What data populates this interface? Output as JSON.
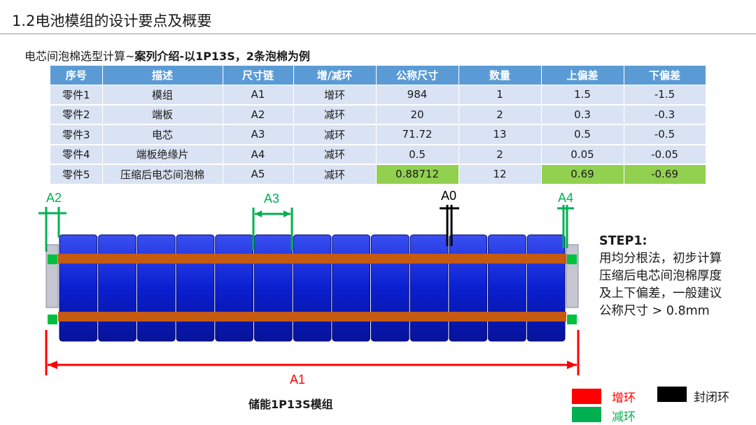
{
  "header": {
    "title": "1.2电池模组的设计要点及概要"
  },
  "subtitle": {
    "prefix": "电芯间泡棉选型计算~",
    "bold": "案列介绍-以1P13S，2条泡棉为例"
  },
  "table": {
    "headers": [
      "序号",
      "描述",
      "尺寸链",
      "增/减环",
      "公称尺寸",
      "数量",
      "上偏差",
      "下偏差"
    ],
    "rows": [
      [
        "零件1",
        "模组",
        "A1",
        "增环",
        "984",
        "1",
        "1.5",
        "-1.5"
      ],
      [
        "零件2",
        "端板",
        "A2",
        "减环",
        "20",
        "2",
        "0.3",
        "-0.3"
      ],
      [
        "零件3",
        "电芯",
        "A3",
        "减环",
        "71.72",
        "13",
        "0.5",
        "-0.5"
      ],
      [
        "零件4",
        "端板绝缘片",
        "A4",
        "减环",
        "0.5",
        "2",
        "0.05",
        "-0.05"
      ],
      [
        "零件5",
        "压缩后电芯间泡棉",
        "A5",
        "减环",
        "0.88712",
        "12",
        "0.69",
        "-0.69"
      ]
    ]
  },
  "diagram": {
    "labels": {
      "a2": "A2",
      "a3": "A3",
      "a0": "A0",
      "a4": "A4",
      "a1": "A1"
    },
    "caption": "储能1P13S模组",
    "colors": {
      "cell": "#0a1fd0",
      "strap": "#c55a11",
      "increase": "#ff0000",
      "decrease": "#00b050",
      "closing": "#000000",
      "endplate": "#c6c6d2"
    }
  },
  "step": {
    "title": "STEP1:",
    "lines": [
      "用均分根法，初步计算",
      "压缩后电芯间泡棉厚度",
      "及上下偏差，一般建议",
      "公称尺寸 > 0.8mm"
    ]
  },
  "legend": {
    "increase": "增环",
    "decrease": "减环",
    "closing": "封闭环"
  }
}
